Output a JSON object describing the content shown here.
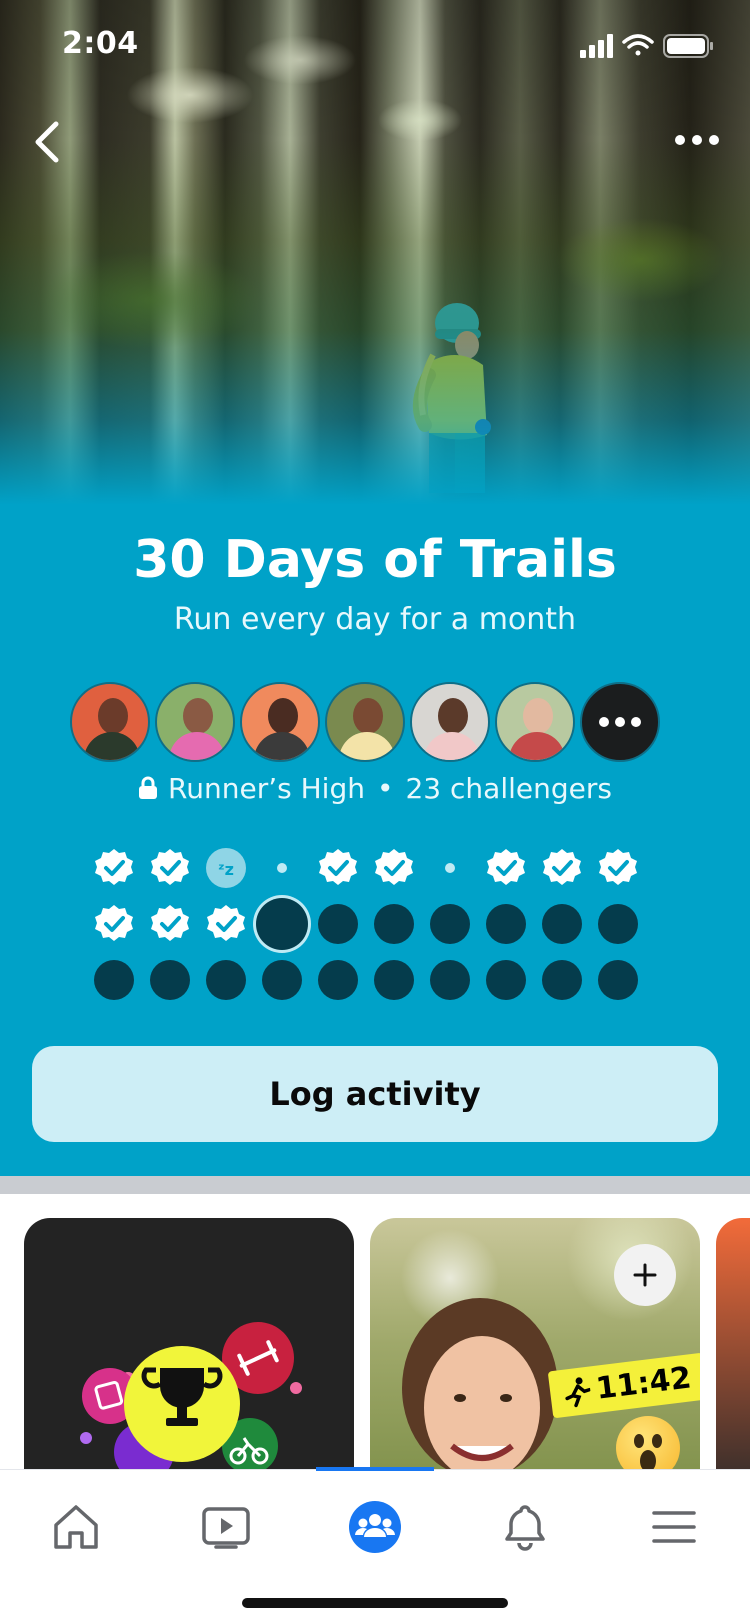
{
  "status_bar": {
    "time": "2:04"
  },
  "challenge": {
    "title": "30 Days of Trails",
    "subtitle": "Run every day for a month",
    "group_name": "Runner’s High",
    "separator": "•",
    "challengers": "23 challengers"
  },
  "participants": [
    {
      "name": "participant-1"
    },
    {
      "name": "participant-2"
    },
    {
      "name": "participant-3"
    },
    {
      "name": "participant-4"
    },
    {
      "name": "participant-5"
    },
    {
      "name": "participant-6"
    }
  ],
  "progress": {
    "days_total": 30,
    "current_day": 14,
    "days": [
      "done",
      "done",
      "rest",
      "skip",
      "done",
      "done",
      "skip",
      "done",
      "done",
      "done",
      "done",
      "done",
      "done",
      "today",
      "future",
      "future",
      "future",
      "future",
      "future",
      "future",
      "future",
      "future",
      "future",
      "future",
      "future",
      "future",
      "future",
      "future",
      "future",
      "future"
    ]
  },
  "actions": {
    "log_activity": "Log activity"
  },
  "stories": {
    "timer_sticker": "11:42"
  },
  "tabbar": {
    "active": "groups",
    "items": [
      "home-icon",
      "watch-icon",
      "groups-icon",
      "notifications-icon",
      "menu-icon"
    ]
  },
  "colors": {
    "accent": "#00a2c8",
    "button_bg": "#cdeef6",
    "dot_future": "#053c4c",
    "tab_active": "#1877f2"
  }
}
